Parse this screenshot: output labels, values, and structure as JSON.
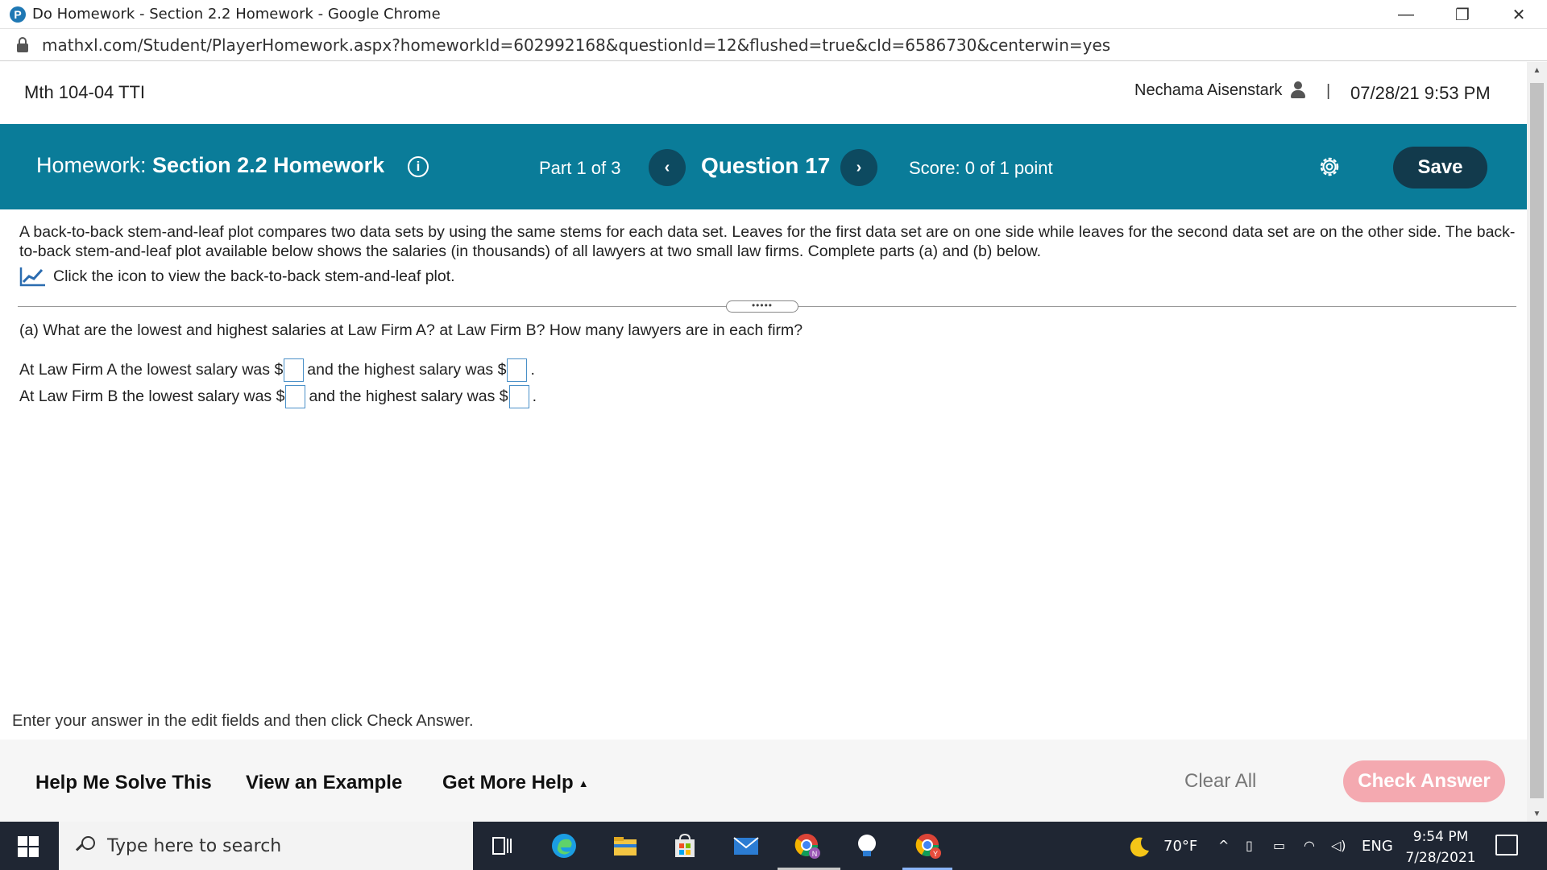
{
  "window": {
    "title": "Do Homework - Section 2.2 Homework - Google Chrome",
    "minimize": "—",
    "restore": "❐",
    "close": "✕"
  },
  "address": {
    "url": "mathxl.com/Student/PlayerHomework.aspx?homeworkId=602992168&questionId=12&flushed=true&cId=6586730&centerwin=yes"
  },
  "course": {
    "name": "Mth 104-04 TTI",
    "user": "Nechama Aisenstark",
    "separator": "|",
    "datetime": "07/28/21 9:53 PM"
  },
  "homework": {
    "label": "Homework:",
    "title": "Section 2.2 Homework",
    "info_icon": "i",
    "part": "Part 1 of 3",
    "prev": "‹",
    "question": "Question 17",
    "next": "›",
    "score": "Score: 0 of 1 point",
    "save": "Save"
  },
  "question": {
    "intro": "A back-to-back stem-and-leaf plot compares two data sets by using the same stems for each data set. Leaves for the first data set are on one side while leaves for the second data set are on the other side. The back-to-back stem-and-leaf plot available below shows the salaries (in thousands) of all lawyers at two small law firms. Complete parts (a) and (b) below.",
    "plot_link": "Click the icon to view the back-to-back stem-and-leaf plot.",
    "expander": "•••••",
    "part_a": "(a) What are the lowest and highest salaries at Law Firm A? at Law Firm B? How many lawyers are in each firm?",
    "line_a_1": "At Law Firm A the lowest salary was $",
    "line_a_2": "and the highest salary was $",
    "line_b_1": "At Law Firm B the lowest salary was $",
    "line_b_2": "and the highest salary was $",
    "period": ".",
    "instruction": "Enter your answer in the edit fields and then click Check Answer."
  },
  "toolbar": {
    "help_me_solve": "Help Me Solve This",
    "view_example": "View an Example",
    "get_more_help": "Get More Help",
    "get_more_help_caret": "▲",
    "clear_all": "Clear All",
    "check_answer": "Check Answer"
  },
  "taskbar": {
    "search_placeholder": "Type here to search",
    "weather": "70°F",
    "language": "ENG",
    "time": "9:54 PM",
    "date": "7/28/2021"
  },
  "colors": {
    "header_teal": "#0a7c99",
    "save_button": "#123a4c",
    "check_answer_disabled": "#f4a9b0",
    "answer_box_border": "#4a90c8"
  },
  "icons": [
    "mathxl-p-icon",
    "lock-icon",
    "user-icon",
    "info-icon",
    "chevron-left-icon",
    "chevron-right-icon",
    "gear-icon",
    "chart-line-icon",
    "windows-start-icon",
    "search-icon"
  ]
}
